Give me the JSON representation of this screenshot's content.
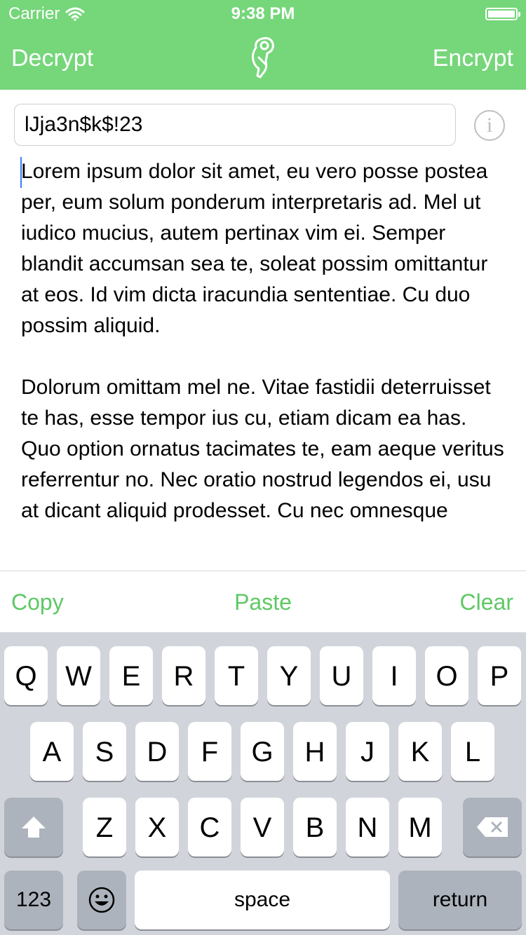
{
  "status_bar": {
    "carrier": "Carrier",
    "time": "9:38 PM"
  },
  "nav": {
    "left_label": "Decrypt",
    "right_label": "Encrypt",
    "logo_icon": "key-icon"
  },
  "key_field": {
    "value": "lJja3n$k$!23"
  },
  "info_icon": {
    "glyph": "i"
  },
  "text": {
    "paragraph1": "Lorem ipsum dolor sit amet, eu vero posse postea per, eum solum ponderum interpretaris ad. Mel ut iudico mucius, autem pertinax vim ei. Semper blandit accumsan sea te, soleat possim omittantur at eos. Id vim dicta iracundia sententiae. Cu duo possim aliquid.",
    "paragraph2": "Dolorum omittam mel ne. Vitae fastidii deterruisset te has, esse tempor ius cu, etiam dicam ea has. Quo option ornatus tacimates te, eam aeque veritus referrentur no. Nec oratio nostrud legendos ei, usu at dicant aliquid prodesset. Cu nec omnesque"
  },
  "actions": {
    "copy": "Copy",
    "paste": "Paste",
    "clear": "Clear"
  },
  "keyboard": {
    "row1": [
      "Q",
      "W",
      "E",
      "R",
      "T",
      "Y",
      "U",
      "I",
      "O",
      "P"
    ],
    "row2": [
      "A",
      "S",
      "D",
      "F",
      "G",
      "H",
      "J",
      "K",
      "L"
    ],
    "row3": [
      "Z",
      "X",
      "C",
      "V",
      "B",
      "N",
      "M"
    ],
    "numbers_key": "123",
    "emoji_key": "☺",
    "space_key": "space",
    "return_key": "return"
  },
  "colors": {
    "accent": "#75d67a",
    "action_text": "#5ec864",
    "keyboard_bg": "#d1d5db"
  }
}
